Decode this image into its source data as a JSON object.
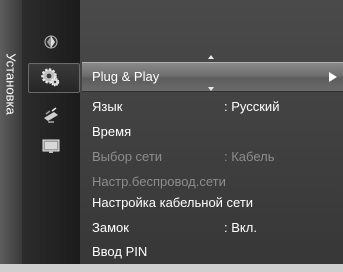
{
  "side_tab": {
    "label": "Установка"
  },
  "icons": [
    {
      "name": "picture-icon"
    },
    {
      "name": "setup-gear-icon"
    },
    {
      "name": "antenna-icon"
    },
    {
      "name": "input-icon"
    }
  ],
  "menu": {
    "selected": {
      "label": "Plug & Play"
    },
    "items": [
      {
        "label": "Язык",
        "value": ": Русский",
        "enabled": true
      },
      {
        "label": "Время",
        "value": "",
        "enabled": true
      },
      {
        "label": "Выбор сети",
        "value": ": Кабель",
        "enabled": false
      },
      {
        "label": "Настр.беспровод.сети",
        "value": "",
        "enabled": false
      },
      {
        "label": "Настройка кабельной сети",
        "value": "",
        "enabled": true
      },
      {
        "label": "Замок",
        "value": ": Вкл.",
        "enabled": true
      },
      {
        "label": "Ввод PIN",
        "value": "",
        "enabled": true
      }
    ]
  },
  "colors": {
    "text": "#ffffff",
    "disabled_text": "#8d8d8d",
    "panel": "#3c3c3c"
  }
}
